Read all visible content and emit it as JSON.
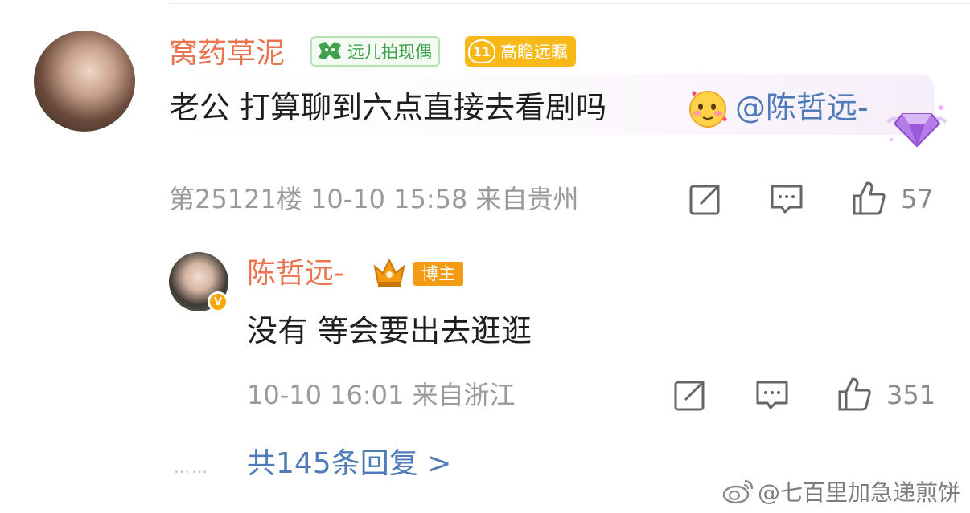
{
  "comment": {
    "username": "窝药草泥",
    "fan_badge": "远儿拍现偶",
    "level_num": "11",
    "level_badge": "高瞻远瞩",
    "text": "老公 打算聊到六点直接去看剧吗",
    "mention": "@陈哲远-",
    "meta": "第25121楼 10-10 15:58 来自贵州",
    "likes": "57"
  },
  "reply": {
    "username": "陈哲远-",
    "role_badge": "博主",
    "verified": "V",
    "text": "没有 等会要出去逛逛",
    "meta": "10-10 16:01 来自浙江",
    "likes": "351"
  },
  "more": {
    "dots": "……",
    "label": "共145条回复 >"
  },
  "watermark": "@七百里加急递煎饼",
  "icons": {
    "share": "share-icon",
    "comment": "comment-icon",
    "like": "thumbs-up-icon",
    "weibo": "weibo-logo-icon"
  },
  "colors": {
    "username": "#eb7350",
    "link": "#4f7cb8",
    "meta": "#9a9a9a",
    "badge_orange": "#f39c12",
    "badge_yellow": "#f8b818",
    "badge_green": "#3fa34d"
  }
}
